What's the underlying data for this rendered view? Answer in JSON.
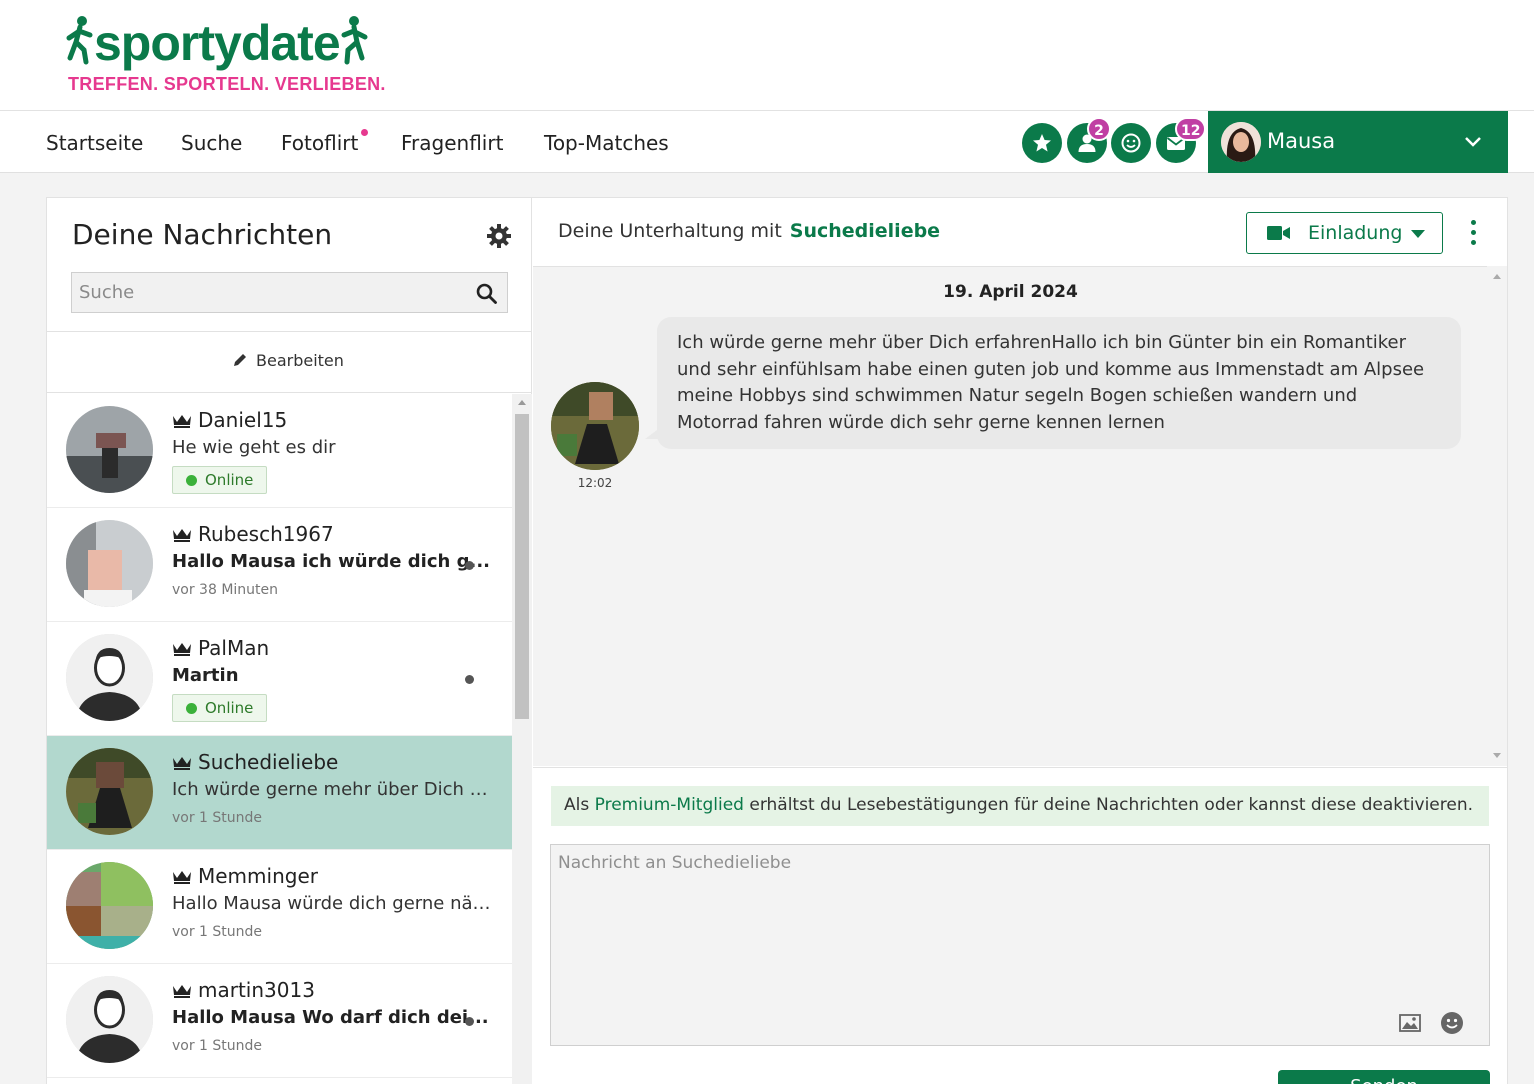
{
  "brand": {
    "name_part1": "sporty",
    "name_part2": "date",
    "tagline": "TREFFEN. SPORTELN. VERLIEBEN.",
    "green": "#0b7a4a",
    "pink": "#e6398f"
  },
  "nav": {
    "items": [
      "Startseite",
      "Suche",
      "Fotoflirt",
      "Fragenflirt",
      "Top-Matches"
    ],
    "icons": [
      {
        "name": "star-icon",
        "badge": ""
      },
      {
        "name": "visitors-icon",
        "badge": "2"
      },
      {
        "name": "smiley-icon",
        "badge": ""
      },
      {
        "name": "mail-icon",
        "badge": "12"
      }
    ],
    "user": "Mausa"
  },
  "inbox": {
    "title": "Deine Nachrichten",
    "search_placeholder": "Suche",
    "edit_label": "Bearbeiten",
    "conversations": [
      {
        "name": "Daniel15",
        "message": "He wie geht es dir",
        "status": "Online",
        "time": "",
        "unread": false
      },
      {
        "name": "Rubesch1967",
        "message": "Hallo Mausa ich würde dich g...",
        "status": "",
        "time": "vor 38 Minuten",
        "unread": true
      },
      {
        "name": "PalMan",
        "message": "Martin",
        "status": "Online",
        "time": "",
        "unread": true
      },
      {
        "name": "Suchedieliebe",
        "message": "Ich würde gerne mehr über Dich erfa...",
        "status": "",
        "time": "vor 1 Stunde",
        "unread": false,
        "active": true
      },
      {
        "name": "Memminger",
        "message": "Hallo Mausa würde dich gerne näher ...",
        "status": "",
        "time": "vor 1 Stunde",
        "unread": false
      },
      {
        "name": "martin3013",
        "message": "Hallo Mausa Wo darf dich dei...",
        "status": "",
        "time": "vor 1 Stunde",
        "unread": true
      }
    ]
  },
  "chat": {
    "header_prefix": "Deine Unterhaltung mit",
    "partner": "Suchedieliebe",
    "invite_label": "Einladung",
    "date": "19. April 2024",
    "message_text": "Ich würde gerne mehr über Dich erfahrenHallo ich bin Günter bin ein Romantiker und sehr einfühlsam habe einen guten job und komme aus Immenstadt am Alpsee meine Hobbys sind schwimmen Natur segeln Bogen schießen wandern und Motorrad fahren würde dich sehr gerne kennen lernen",
    "message_time": "12:02",
    "premium_prefix": "Als",
    "premium_link": "Premium-Mitglied",
    "premium_suffix": "erhältst du Lesebestätigungen für deine Nachrichten oder kannst diese deaktivieren.",
    "compose_placeholder": "Nachricht an Suchedieliebe",
    "send_label": "Senden"
  }
}
